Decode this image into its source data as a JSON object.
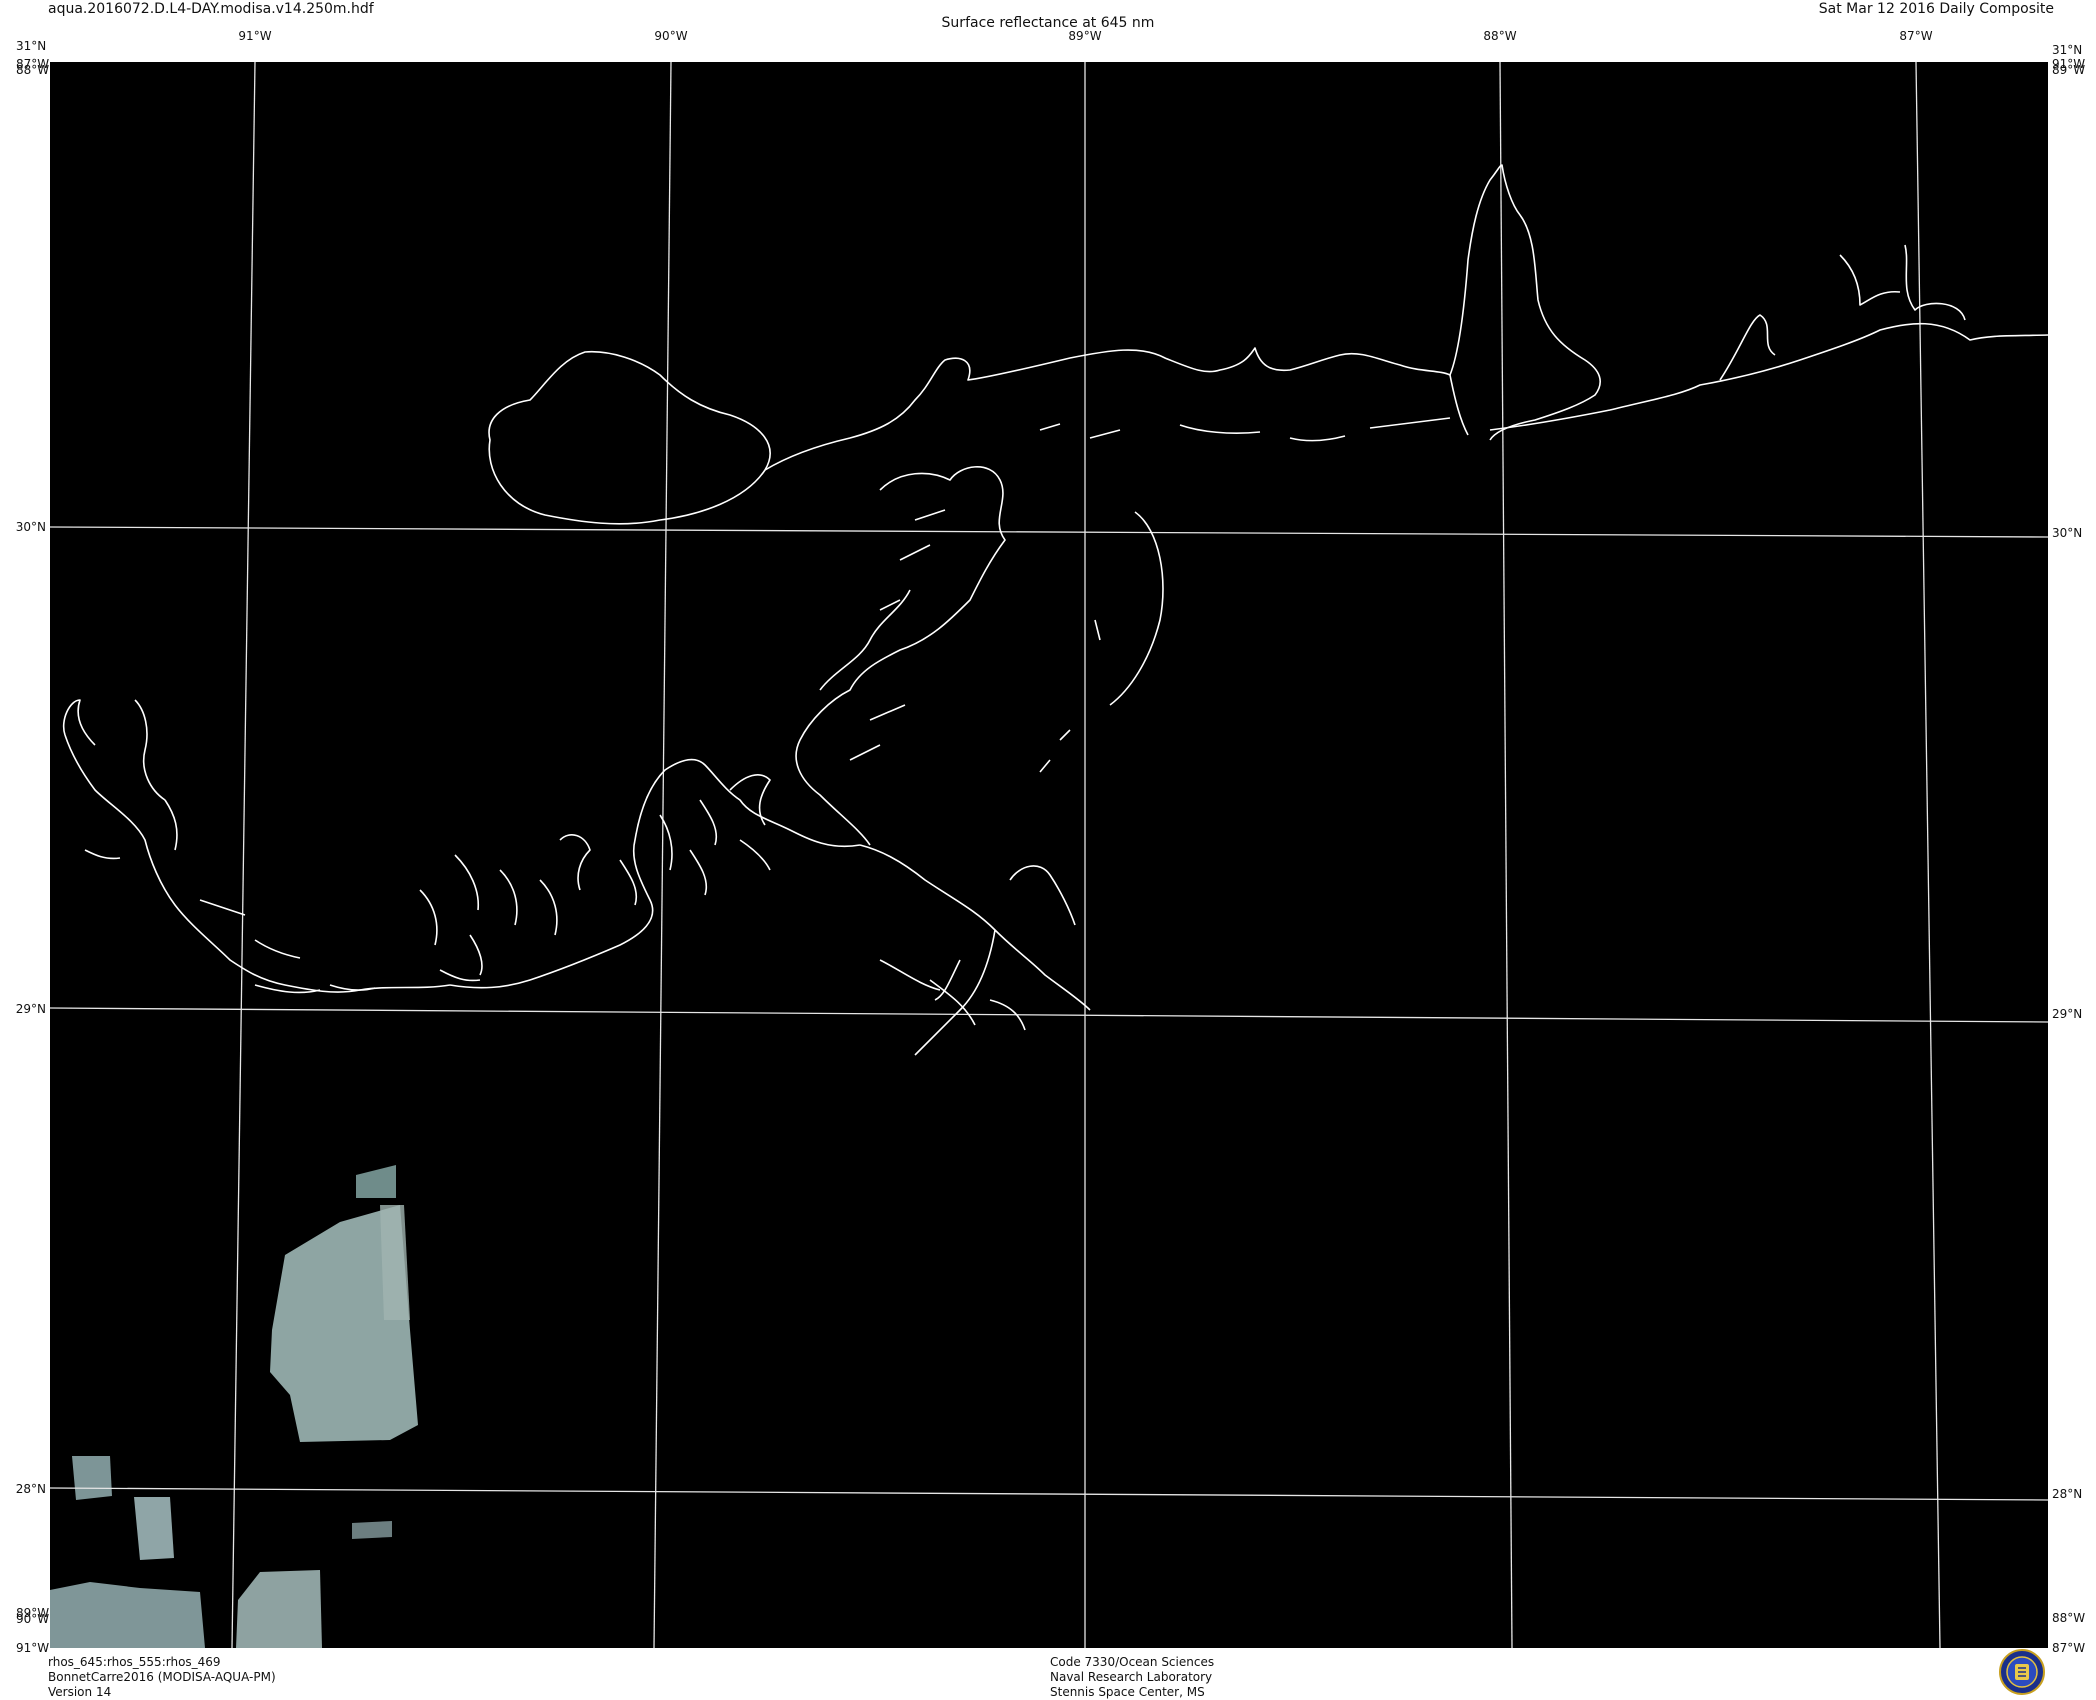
{
  "header": {
    "file_name": "aqua.2016072.D.L4-DAY.modisa.v14.250m.hdf",
    "title": "Surface reflectance at 645 nm",
    "date": "Sat Mar 12 2016 Daily Composite"
  },
  "map": {
    "top_labels": [
      "91°W",
      "90°W",
      "89°W",
      "88°W",
      "87°W"
    ],
    "left_labels": [
      "30°N",
      "29°N",
      "28°N"
    ],
    "right_labels": [
      "30°N",
      "29°N",
      "28°N"
    ],
    "corners": {
      "top_left_lat": "31°N",
      "top_left_lon": "87°W",
      "top_left_lon2": "88°W",
      "top_right_lat": "31°N",
      "top_right_lon": "91°W",
      "top_right_lon2": "89°W",
      "bottom_left_lon": "89°W",
      "bottom_left_lon2": "90°W",
      "bottom_left_lon3": "91°W",
      "bottom_right_lon": "88°W",
      "bottom_right_lon2": "87°W"
    },
    "colors": {
      "background": "#000000",
      "grid": "#e6e6e6",
      "coastline": "#ffffff",
      "imagery": "#8ea5a3"
    }
  },
  "footer": {
    "left": [
      "rhos_645:rhos_555:rhos_469",
      "BonnetCarre2016 (MODISA-AQUA-PM)",
      "Version 14"
    ],
    "center": [
      "Code 7330/Ocean Sciences",
      "Naval Research Laboratory",
      "Stennis Space Center, MS"
    ]
  }
}
